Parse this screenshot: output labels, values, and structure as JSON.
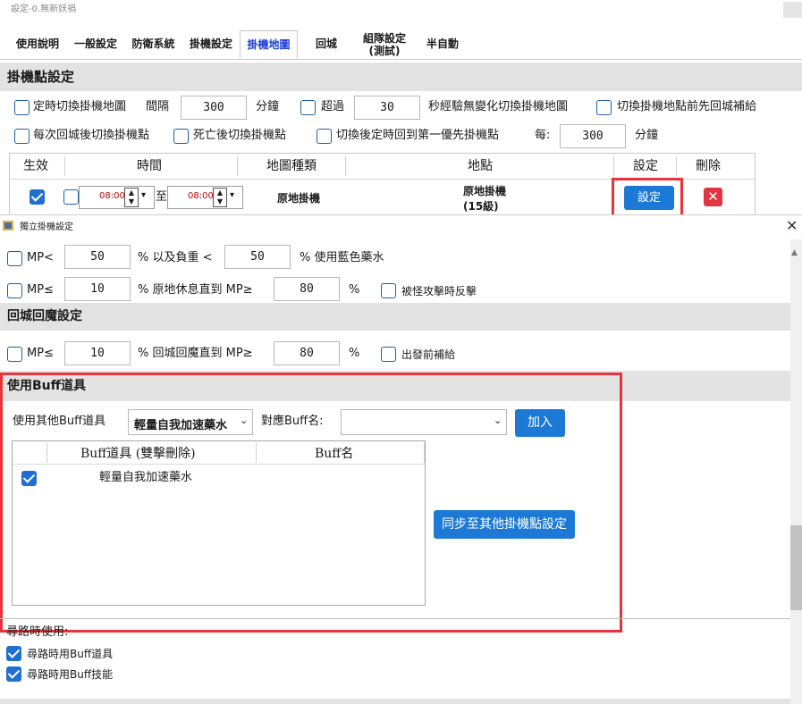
{
  "top_window": {
    "title": "設定-0.無新妖禍",
    "tabs": [
      {
        "label": "使用說明",
        "active": false
      },
      {
        "label": "一般設定",
        "active": false
      },
      {
        "label": "防衛系統",
        "active": false
      },
      {
        "label": "掛機設定",
        "active": false
      },
      {
        "label": "掛機地圖",
        "active": true
      },
      {
        "label": "回城",
        "active": false
      },
      {
        "label": "組隊設定\n(測試)",
        "active": false
      },
      {
        "label": "半自動",
        "active": false
      }
    ],
    "section_title": "掛機點設定",
    "row1": {
      "timed_switch_label": "定時切換掛機地圖",
      "interval_label": "間隔",
      "interval_value": "300",
      "minutes_label": "分鐘",
      "exceed_label": "超過",
      "exceed_value": "30",
      "exp_label": "秒經驗無變化切換掛機地圖",
      "return_supply_label": "切換掛機地點前先回城補給"
    },
    "row2": {
      "switch_after_return_label": "每次回城後切換掛機點",
      "switch_after_death_label": "死亡後切換掛機點",
      "back_first_label": "切換後定時回到第一優先掛機點",
      "every_label": "每:",
      "every_value": "300",
      "minutes_label": "分鐘"
    },
    "table": {
      "headers": [
        "生效",
        "時間",
        "地圖種類",
        "地點",
        "設定",
        "刪除"
      ],
      "row": {
        "time_from": "08:00",
        "to_label": "至",
        "time_to": "08:00",
        "map_type": "原地掛機",
        "location_line1": "原地掛機",
        "location_line2": "(15級)",
        "settings_button": "設定"
      }
    }
  },
  "dialog": {
    "title": "獨立掛機設定",
    "mp_row1": {
      "mp_label": "MP<",
      "mp_value": "50",
      "weight_label": "% 以及負重 <",
      "weight_value": "50",
      "use_label": "% 使用藍色藥水"
    },
    "mp_row2": {
      "mp_label": "MP≤",
      "mp_value": "10",
      "rest_label": "% 原地休息直到 MP≥",
      "rest_value": "80",
      "pct_label": "%",
      "counter_label": "被怪攻擊時反擊"
    },
    "return_section_title": "回城回魔設定",
    "mp_row3": {
      "mp_label": "MP≤",
      "mp_value": "10",
      "return_label": "% 回城回魔直到 MP≥",
      "return_value": "80",
      "pct_label": "%",
      "supply_label": "出發前補給"
    },
    "buff_section_title": "使用Buff道具",
    "buff": {
      "other_label": "使用其他Buff道具",
      "item_select": "輕量自我加速藥水",
      "buff_name_label": "對應Buff名:",
      "buff_name_select": "",
      "add_button": "加入",
      "table_headers": [
        "Buff道具 (雙擊刪除)",
        "Buff名"
      ],
      "rows": [
        {
          "item": "輕量自我加速藥水",
          "buff": ""
        }
      ],
      "sync_button": "同步至其他掛機點設定"
    },
    "pathing_label": "尋路時使用:",
    "pathing_item_label": "尋路時用Buff道具",
    "pathing_skill_label": "尋路時用Buff技能"
  }
}
